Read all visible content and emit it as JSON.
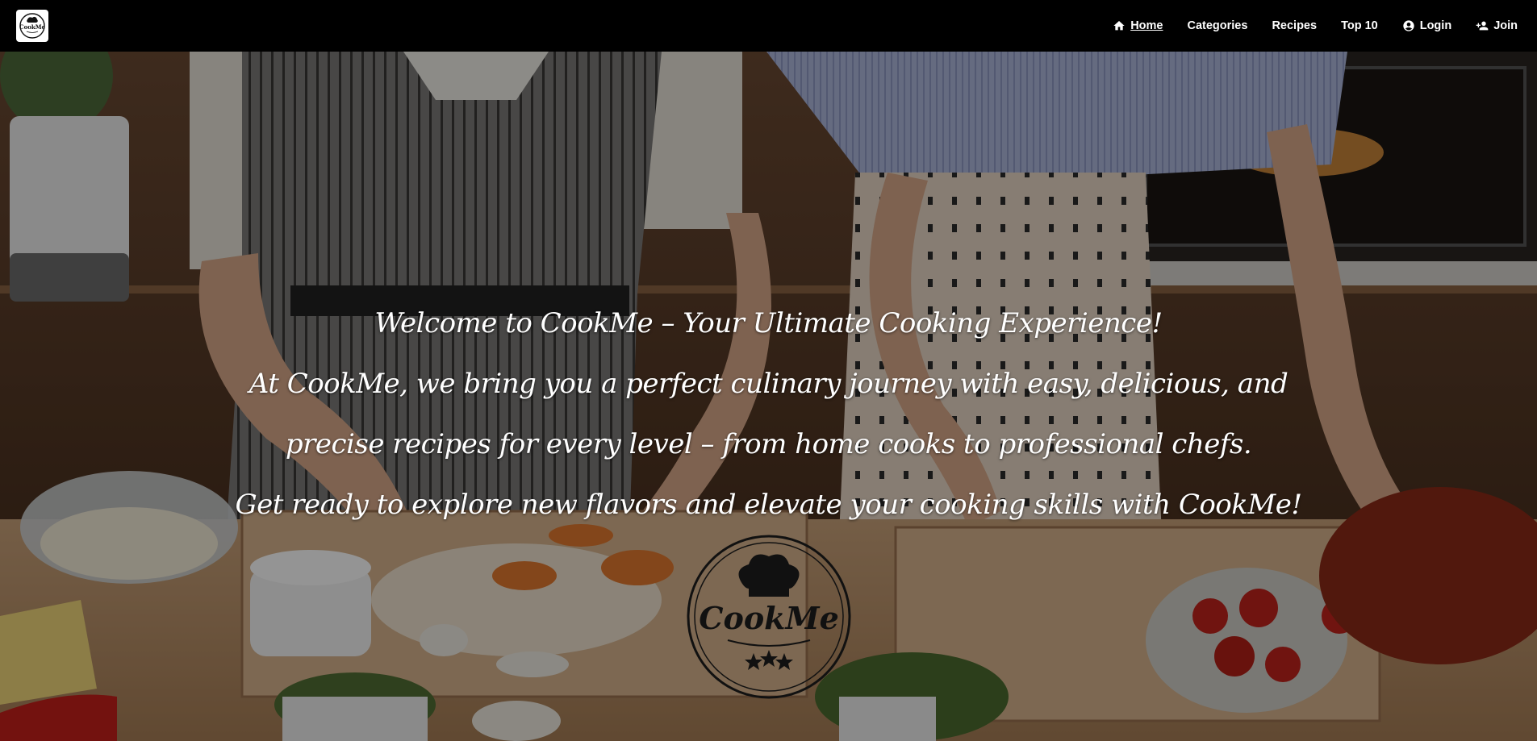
{
  "brand": {
    "logo_text": "CookMe"
  },
  "nav": {
    "items": [
      {
        "label": "Home",
        "icon": "home-icon",
        "active": true
      },
      {
        "label": "Categories",
        "icon": null,
        "active": false
      },
      {
        "label": "Recipes",
        "icon": null,
        "active": false
      },
      {
        "label": "Top 10",
        "icon": null,
        "active": false
      },
      {
        "label": "Login",
        "icon": "account-circle-icon",
        "active": false
      },
      {
        "label": "Join",
        "icon": "person-add-icon",
        "active": false
      }
    ]
  },
  "hero": {
    "lines": [
      "Welcome to CookMe – Your Ultimate Cooking Experience!",
      "At CookMe, we bring you a perfect culinary journey with easy, delicious, and",
      "precise recipes for every level – from home cooks to professional chefs.",
      "Get ready to explore new flavors and elevate your cooking skills with CookMe!"
    ],
    "logo_text": "CookMe"
  },
  "colors": {
    "navbar": "#000000",
    "text": "#ffffff",
    "overlay": "rgba(0,0,0,0.42)"
  }
}
